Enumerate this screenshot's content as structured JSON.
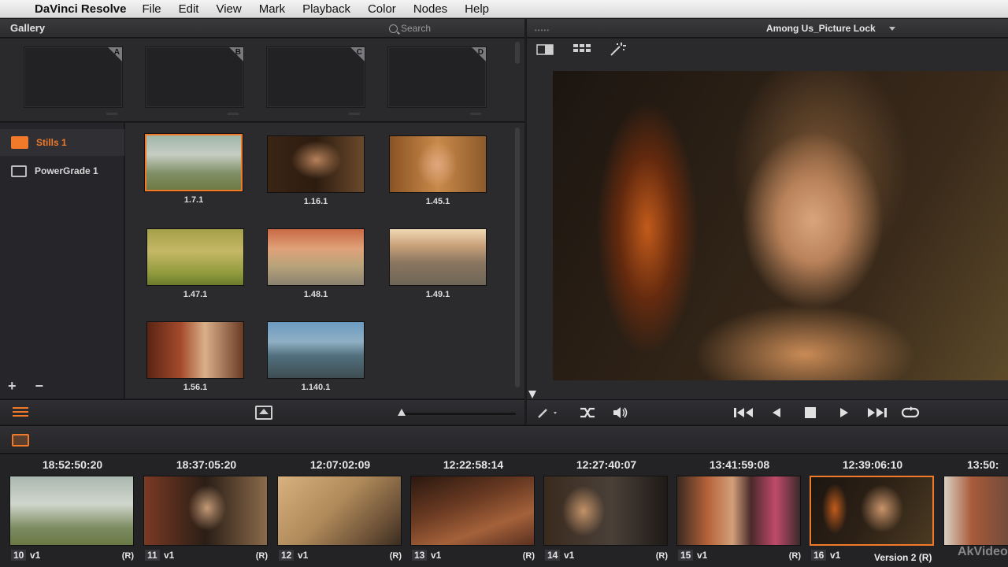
{
  "menubar": {
    "app_name": "DaVinci Resolve",
    "items": [
      "File",
      "Edit",
      "View",
      "Mark",
      "Playback",
      "Color",
      "Nodes",
      "Help"
    ]
  },
  "gallery": {
    "title": "Gallery",
    "search_placeholder": "Search",
    "memories": [
      "A",
      "B",
      "C",
      "D"
    ],
    "albums": [
      {
        "label": "Stills 1",
        "selected": true
      },
      {
        "label": "PowerGrade 1",
        "selected": false
      }
    ],
    "add_label": "+",
    "remove_label": "−",
    "stills": [
      {
        "label": "1.7.1",
        "selected": true
      },
      {
        "label": "1.16.1",
        "selected": false
      },
      {
        "label": "1.45.1",
        "selected": false
      },
      {
        "label": "1.47.1",
        "selected": false
      },
      {
        "label": "1.48.1",
        "selected": false
      },
      {
        "label": "1.49.1",
        "selected": false
      },
      {
        "label": "1.56.1",
        "selected": false
      },
      {
        "label": "1.140.1",
        "selected": false
      }
    ]
  },
  "viewer": {
    "timeline_name": "Among Us_Picture Lock"
  },
  "timeline": {
    "clips": [
      {
        "timecode": "18:52:50:20",
        "num": "10",
        "track": "v1",
        "flag": "(R)"
      },
      {
        "timecode": "18:37:05:20",
        "num": "11",
        "track": "v1",
        "flag": "(R)"
      },
      {
        "timecode": "12:07:02:09",
        "num": "12",
        "track": "v1",
        "flag": "(R)"
      },
      {
        "timecode": "12:22:58:14",
        "num": "13",
        "track": "v1",
        "flag": "(R)"
      },
      {
        "timecode": "12:27:40:07",
        "num": "14",
        "track": "v1",
        "flag": "(R)"
      },
      {
        "timecode": "13:41:59:08",
        "num": "15",
        "track": "v1",
        "flag": "(R)"
      },
      {
        "timecode": "12:39:06:10",
        "num": "16",
        "track": "v1",
        "flag": ""
      },
      {
        "timecode": "13:50:",
        "num": "",
        "track": "",
        "flag": ""
      }
    ],
    "version_label": "Version 2 (R)",
    "watermark": "AkVideo"
  },
  "colors": {
    "accent": "#f07a2a",
    "panel": "#2b2b2e"
  }
}
